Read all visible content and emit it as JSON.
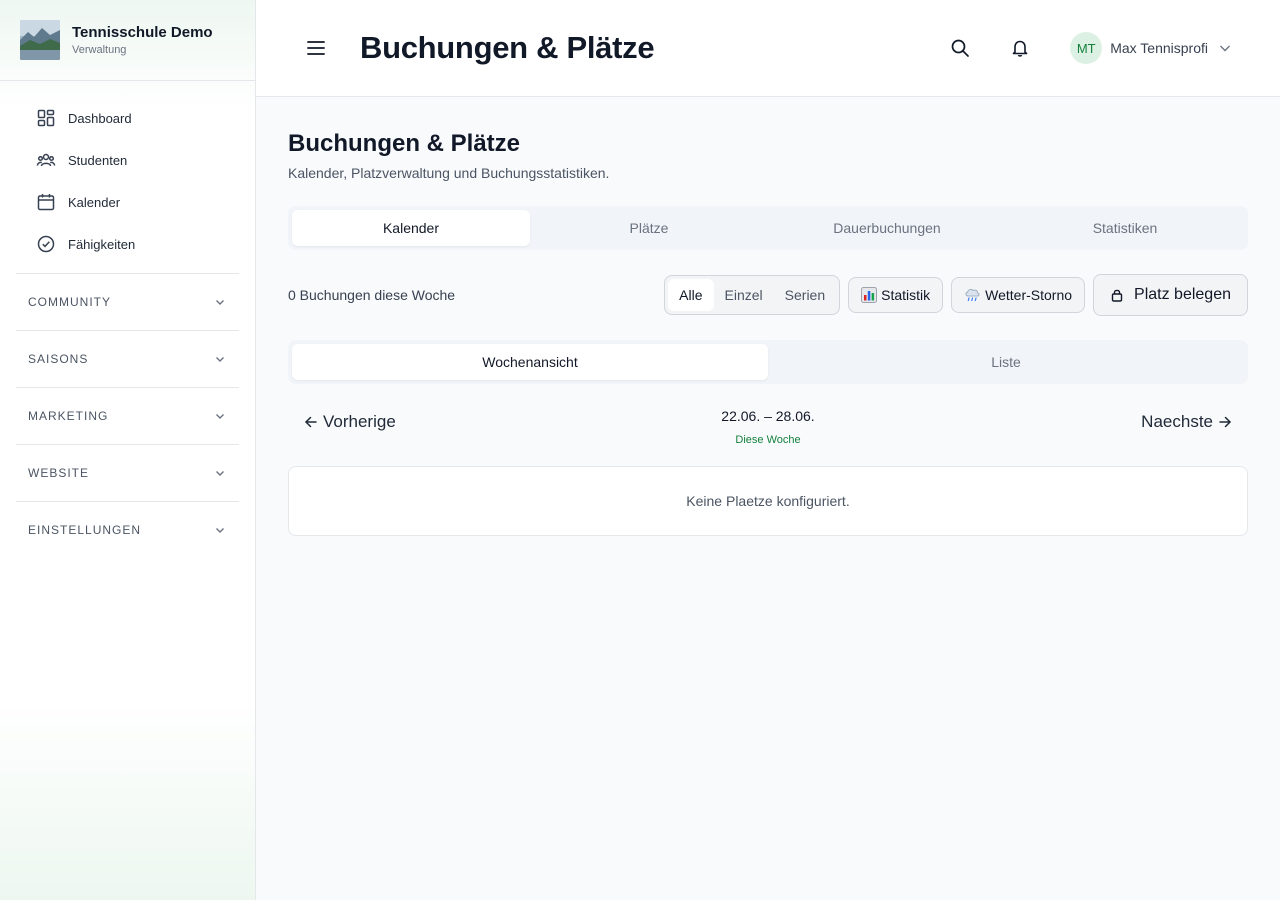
{
  "brand": {
    "name": "Tennisschule Demo",
    "subtitle": "Verwaltung",
    "logo_icon": "landscape-logo"
  },
  "sidebar": {
    "items": [
      {
        "label": "Dashboard",
        "icon": "dashboard-icon"
      },
      {
        "label": "Studenten",
        "icon": "users-icon"
      },
      {
        "label": "Kalender",
        "icon": "calendar-icon"
      },
      {
        "label": "Fähigkeiten",
        "icon": "check-circle-icon"
      }
    ],
    "sections": [
      {
        "label": "COMMUNITY"
      },
      {
        "label": "SAISONS"
      },
      {
        "label": "MARKETING"
      },
      {
        "label": "WEBSITE"
      },
      {
        "label": "EINSTELLUNGEN"
      }
    ]
  },
  "header": {
    "title": "Buchungen & Plätze",
    "user": {
      "initials": "MT",
      "name": "Max Tennisprofi"
    }
  },
  "page": {
    "title": "Buchungen & Plätze",
    "subtitle": "Kalender, Platzverwaltung und Buchungsstatistiken."
  },
  "tabs": [
    {
      "label": "Kalender",
      "active": true
    },
    {
      "label": "Plätze",
      "active": false
    },
    {
      "label": "Dauerbuchungen",
      "active": false
    },
    {
      "label": "Statistiken",
      "active": false
    }
  ],
  "toolbar": {
    "count_text": "0 Buchungen diese Woche",
    "filters": [
      {
        "label": "Alle",
        "active": true
      },
      {
        "label": "Einzel",
        "active": false
      },
      {
        "label": "Serien",
        "active": false
      }
    ],
    "stats_label": "Statistik",
    "weather_label": "Wetter-Storno",
    "book_label": "Platz belegen"
  },
  "view_tabs": [
    {
      "label": "Wochenansicht",
      "active": true
    },
    {
      "label": "Liste",
      "active": false
    }
  ],
  "week": {
    "prev_label": "Vorherige",
    "next_label": "Naechste",
    "range": "22.06. – 28.06.",
    "current_label": "Diese Woche"
  },
  "empty_state": "Keine Plaetze konfiguriert.",
  "colors": {
    "accent": "#15803d",
    "avatar_bg": "#dcf1e3",
    "tab_bg": "#f1f5f9"
  }
}
